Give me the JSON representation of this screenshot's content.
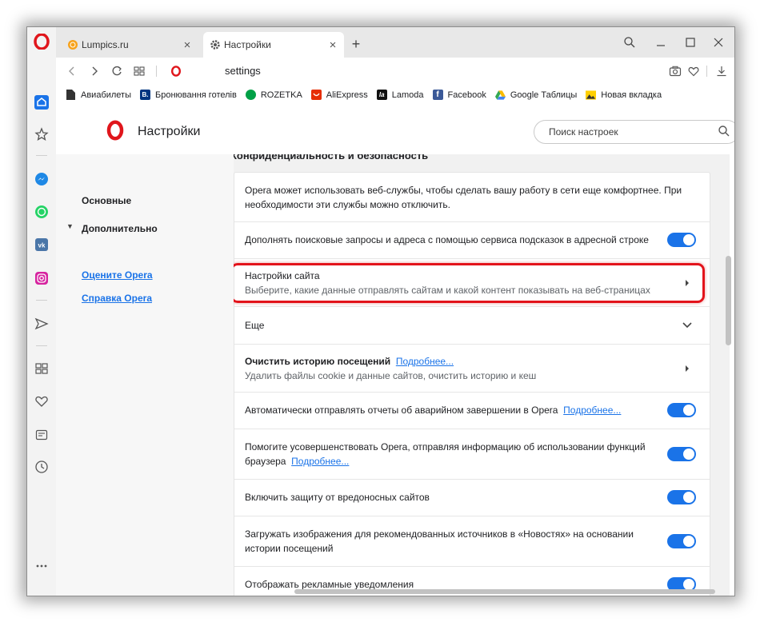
{
  "tabs": [
    {
      "title": "Lumpics.ru",
      "active": false
    },
    {
      "title": "Настройки",
      "active": true
    }
  ],
  "address": {
    "url": "settings"
  },
  "bookmarks": [
    {
      "label": "Авиабилеты",
      "icon": "document-icon"
    },
    {
      "label": "Бронювання готелів",
      "icon": "booking-icon",
      "badge": "B."
    },
    {
      "label": "ROZETKA",
      "icon": "rozetka-icon"
    },
    {
      "label": "AliExpress",
      "icon": "aliexpress-icon"
    },
    {
      "label": "Lamoda",
      "icon": "lamoda-icon",
      "badge": "la"
    },
    {
      "label": "Facebook",
      "icon": "facebook-icon",
      "badge": "f"
    },
    {
      "label": "Google Таблицы",
      "icon": "google-drive-icon"
    },
    {
      "label": "Новая вкладка",
      "icon": "new-tab-icon"
    }
  ],
  "settings": {
    "title": "Настройки",
    "search_placeholder": "Поиск настроек",
    "nav": {
      "basic": "Основные",
      "advanced": "Дополнительно",
      "rate": "Оцените Opera",
      "help": "Справка Opera"
    },
    "section_title": "Конфиденциальность и безопасность",
    "rows": {
      "intro": "Opera может использовать веб-службы, чтобы сделать вашу работу в сети еще комфортнее. При необходимости эти службы можно отключить.",
      "suggest": "Дополнять поисковые запросы и адреса с помощью сервиса подсказок в адресной строке",
      "site_title": "Настройки сайта",
      "site_sub": "Выберите, какие данные отправлять сайтам и какой контент показывать на веб-страницах",
      "more": "Еще",
      "clear_title": "Очистить историю посещений",
      "more_link": "Подробнее...",
      "clear_sub": "Удалить файлы cookie и данные сайтов, очистить историю и кеш",
      "crash": "Автоматически отправлять отчеты об аварийном завершении в Opera",
      "improve": "Помогите усовершенствовать Opera, отправляя информацию об использовании функций браузера",
      "protect": "Включить защиту от вредоносных сайтов",
      "news": "Загружать изображения для рекомендованных источников в «Новостях» на основании истории посещений",
      "ads": "Отображать рекламные уведомления"
    },
    "toggles": {
      "suggest": true,
      "crash": true,
      "improve": true,
      "protect": true,
      "news": true,
      "ads": true
    }
  },
  "colors": {
    "accent": "#1a73e8",
    "highlight": "#e3131b",
    "opera_red": "#e0161c"
  }
}
